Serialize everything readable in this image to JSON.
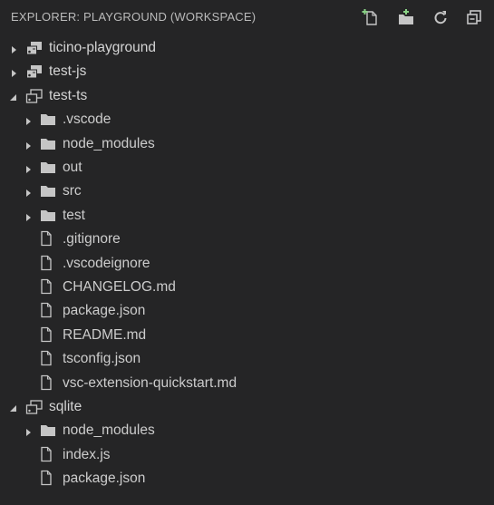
{
  "header": {
    "title": "EXPLORER: PLAYGROUND (WORKSPACE)",
    "actions": [
      "new-file-icon",
      "new-folder-icon",
      "refresh-icon",
      "collapse-all-icon"
    ]
  },
  "tree": [
    {
      "label": "ticino-playground",
      "type": "root",
      "expanded": false,
      "level": 0
    },
    {
      "label": "test-js",
      "type": "root",
      "expanded": false,
      "level": 0
    },
    {
      "label": "test-ts",
      "type": "root",
      "expanded": true,
      "level": 0
    },
    {
      "label": ".vscode",
      "type": "folder",
      "expanded": false,
      "level": 1
    },
    {
      "label": "node_modules",
      "type": "folder",
      "expanded": false,
      "level": 1
    },
    {
      "label": "out",
      "type": "folder",
      "expanded": false,
      "level": 1
    },
    {
      "label": "src",
      "type": "folder",
      "expanded": false,
      "level": 1
    },
    {
      "label": "test",
      "type": "folder",
      "expanded": false,
      "level": 1
    },
    {
      "label": ".gitignore",
      "type": "file",
      "level": 1
    },
    {
      "label": ".vscodeignore",
      "type": "file",
      "level": 1
    },
    {
      "label": "CHANGELOG.md",
      "type": "file",
      "level": 1
    },
    {
      "label": "package.json",
      "type": "file",
      "level": 1
    },
    {
      "label": "README.md",
      "type": "file",
      "level": 1
    },
    {
      "label": "tsconfig.json",
      "type": "file",
      "level": 1
    },
    {
      "label": "vsc-extension-quickstart.md",
      "type": "file",
      "level": 1
    },
    {
      "label": "sqlite",
      "type": "root",
      "expanded": true,
      "level": 0
    },
    {
      "label": "node_modules",
      "type": "folder",
      "expanded": false,
      "level": 1
    },
    {
      "label": "index.js",
      "type": "file",
      "level": 1
    },
    {
      "label": "package.json",
      "type": "file",
      "level": 1
    }
  ],
  "colors": {
    "background": "#252526",
    "text": "#cccccc",
    "icon": "#c5c5c5",
    "new_badge": "#89d185"
  }
}
